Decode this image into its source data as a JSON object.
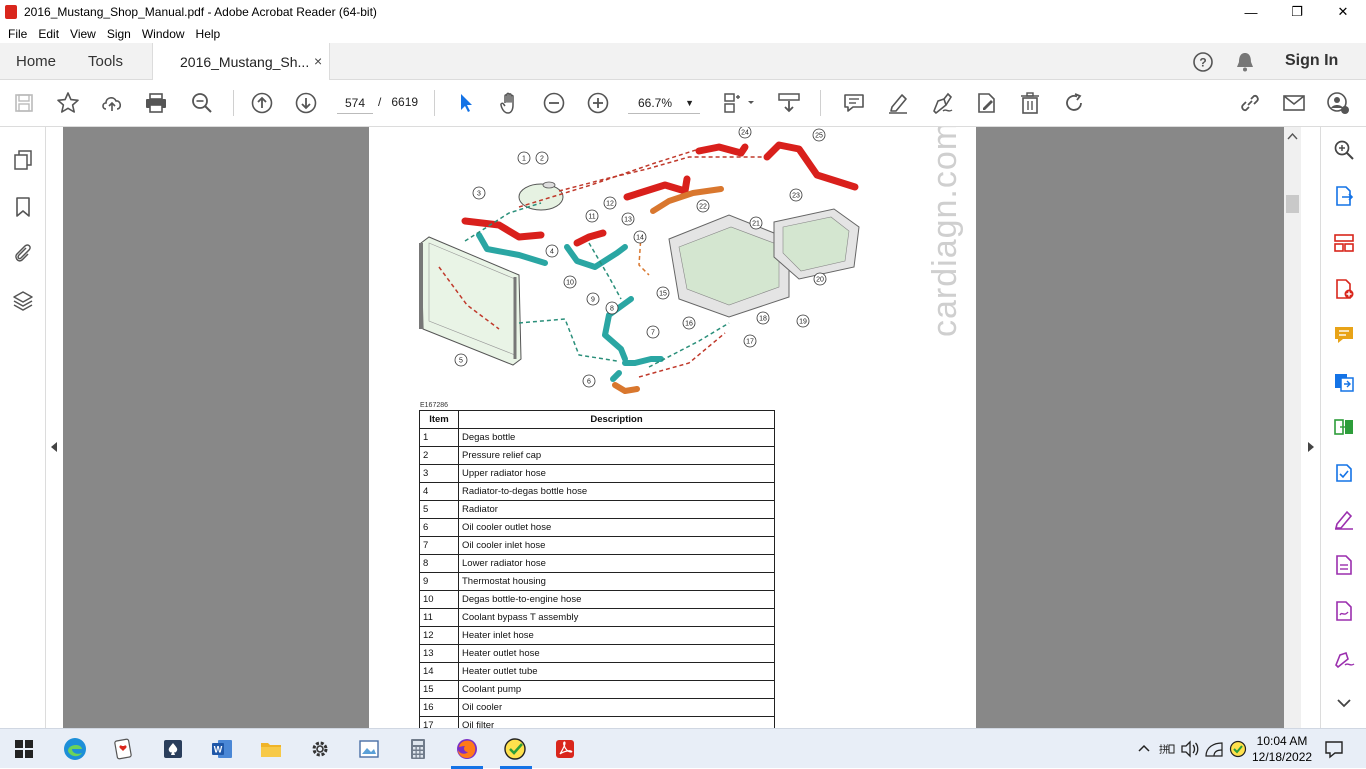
{
  "window": {
    "title": "2016_Mustang_Shop_Manual.pdf - Adobe Acrobat Reader (64-bit)",
    "minimize": "—",
    "maximize": "❐",
    "close": "✕"
  },
  "menu": [
    "File",
    "Edit",
    "View",
    "Sign",
    "Window",
    "Help"
  ],
  "tabs": {
    "home": "Home",
    "tools": "Tools",
    "document": "2016_Mustang_Sh...",
    "close": "×",
    "sign_in": "Sign In"
  },
  "toolbar": {
    "current_page": "574",
    "separator": "/",
    "total_pages": "6619",
    "zoom": "66.7%"
  },
  "document": {
    "watermark": "cardiagn.com",
    "figure_id": "E167286",
    "table": {
      "headers": [
        "Item",
        "Description"
      ],
      "rows": [
        [
          "1",
          "Degas bottle"
        ],
        [
          "2",
          "Pressure relief cap"
        ],
        [
          "3",
          "Upper radiator hose"
        ],
        [
          "4",
          "Radiator-to-degas bottle hose"
        ],
        [
          "5",
          "Radiator"
        ],
        [
          "6",
          "Oil cooler outlet hose"
        ],
        [
          "7",
          "Oil cooler inlet hose"
        ],
        [
          "8",
          "Lower radiator hose"
        ],
        [
          "9",
          "Thermostat housing"
        ],
        [
          "10",
          "Degas bottle-to-engine hose"
        ],
        [
          "11",
          "Coolant bypass T assembly"
        ],
        [
          "12",
          "Heater inlet hose"
        ],
        [
          "13",
          "Heater outlet hose"
        ],
        [
          "14",
          "Heater outlet tube"
        ],
        [
          "15",
          "Coolant pump"
        ],
        [
          "16",
          "Oil cooler"
        ],
        [
          "17",
          "Oil filter"
        ]
      ]
    },
    "callouts": [
      "1",
      "2",
      "3",
      "4",
      "5",
      "6",
      "7",
      "8",
      "9",
      "10",
      "11",
      "12",
      "13",
      "14",
      "15",
      "16",
      "17",
      "18",
      "19",
      "20",
      "21",
      "22",
      "23",
      "24",
      "25"
    ]
  },
  "taskbar": {
    "time": "10:04 AM",
    "date": "12/18/2022"
  },
  "colors": {
    "hose_red": "#d9201c",
    "hose_teal": "#2aa6a3",
    "hose_orange": "#d9772e",
    "acrobat_red": "#d9261c",
    "rail_icon": "#1473e6"
  }
}
